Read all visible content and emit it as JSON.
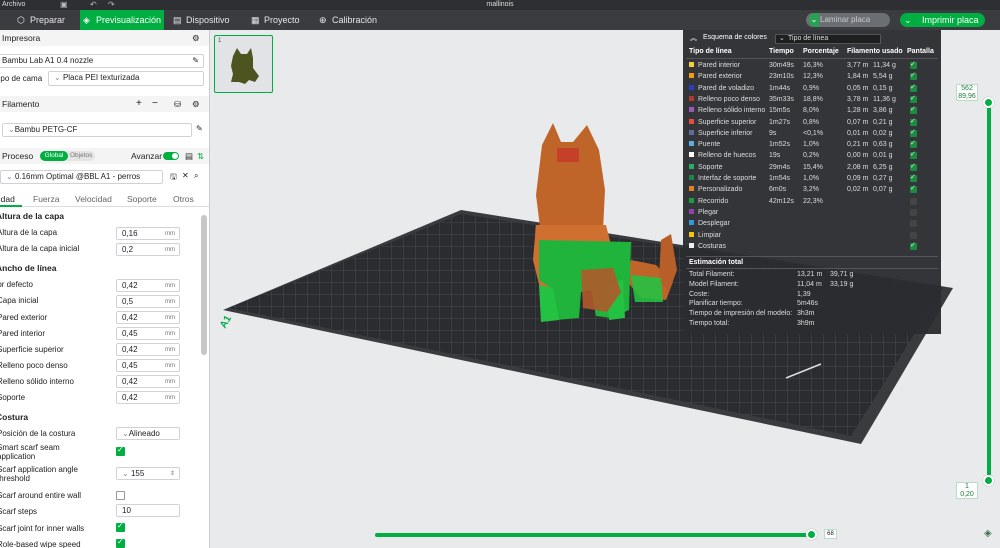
{
  "window": {
    "menu_label": "Archivo",
    "title": "mallinois"
  },
  "tabs": [
    {
      "label": "Preparar",
      "icon": "cube-icon"
    },
    {
      "label": "Previsualización",
      "icon": "preview-icon"
    },
    {
      "label": "Dispositivo",
      "icon": "device-icon"
    },
    {
      "label": "Proyecto",
      "icon": "project-icon"
    },
    {
      "label": "Calibración",
      "icon": "calibration-icon"
    }
  ],
  "toolbar": {
    "slice_label": "Laminar placa",
    "print_label": "Imprimir placa"
  },
  "printer": {
    "section_label": "Impresora",
    "name": "Bambu Lab A1 0.4 nozzle",
    "bed_label": "Tipo de cama",
    "bed_value": "Placa PEI texturizada"
  },
  "filament": {
    "section_label": "Filamento",
    "value": "Bambu PETG-CF"
  },
  "process": {
    "section_label": "Proceso",
    "toggle_global": "Global",
    "toggle_objects": "Objetos",
    "advanced_label": "Avanzar",
    "preset": "0.16mm Optimal @BBL A1 - perros"
  },
  "subtabs": [
    "Calidad",
    "Fuerza",
    "Velocidad",
    "Soporte",
    "Otros"
  ],
  "quality": {
    "layer_height": {
      "title": "Altura de la capa",
      "rows": [
        {
          "label": "Altura de la capa",
          "value": "0,16",
          "unit": "mm"
        },
        {
          "label": "Altura de la capa inicial",
          "value": "0,2",
          "unit": "mm"
        }
      ]
    },
    "line_width": {
      "title": "Ancho de línea",
      "rows": [
        {
          "label": "Por defecto",
          "value": "0,42",
          "unit": "mm"
        },
        {
          "label": "Capa inicial",
          "value": "0,5",
          "unit": "mm"
        },
        {
          "label": "Pared exterior",
          "value": "0,42",
          "unit": "mm"
        },
        {
          "label": "Pared interior",
          "value": "0,45",
          "unit": "mm"
        },
        {
          "label": "Superficie superior",
          "value": "0,42",
          "unit": "mm"
        },
        {
          "label": "Relleno poco denso",
          "value": "0,45",
          "unit": "mm"
        },
        {
          "label": "Relleno sólido interno",
          "value": "0,42",
          "unit": "mm"
        },
        {
          "label": "Soporte",
          "value": "0,42",
          "unit": "mm"
        }
      ]
    },
    "seam": {
      "title": "Costura",
      "position_label": "Posición de la costura",
      "position_value": "Alineado",
      "smart_scarf_label_1": "Smart scarf seam",
      "smart_scarf_label_2": "application",
      "scarf_angle_label_1": "Scarf application angle",
      "scarf_angle_label_2": "threshold",
      "scarf_angle_value": "155",
      "scarf_around_label": "Scarf around entire wall",
      "scarf_steps_label": "Scarf steps",
      "scarf_steps_value": "10",
      "scarf_inner_label": "Scarf joint for inner walls",
      "role_wipe_label": "Role-based wipe speed"
    }
  },
  "thumbnail": {
    "number": "1"
  },
  "color_scheme": {
    "title": "Esquema de colores",
    "selector": "Tipo de línea",
    "headers": [
      "Tipo de línea",
      "Tiempo",
      "Porcentaje",
      "Filamento usado",
      "Pantalla"
    ],
    "rows": [
      {
        "name": "Pared interior",
        "color": "#f4d03f",
        "time": "30m49s",
        "pct": "16,3%",
        "m": "3,77 m",
        "g": "11,34 g",
        "on": true
      },
      {
        "name": "Pared exterior",
        "color": "#f39c12",
        "time": "23m10s",
        "pct": "12,3%",
        "m": "1,84 m",
        "g": "5,54 g",
        "on": true
      },
      {
        "name": "Pared de voladizo",
        "color": "#2c3ec9",
        "time": "1m44s",
        "pct": "0,9%",
        "m": "0,05 m",
        "g": "0,15 g",
        "on": true
      },
      {
        "name": "Relleno poco denso",
        "color": "#b03a2e",
        "time": "35m33s",
        "pct": "18,8%",
        "m": "3,78 m",
        "g": "11,36 g",
        "on": true
      },
      {
        "name": "Relleno sólido interno",
        "color": "#9b59b6",
        "time": "15m5s",
        "pct": "8,0%",
        "m": "1,28 m",
        "g": "3,86 g",
        "on": true
      },
      {
        "name": "Superficie superior",
        "color": "#e74c3c",
        "time": "1m27s",
        "pct": "0,8%",
        "m": "0,07 m",
        "g": "0,21 g",
        "on": true
      },
      {
        "name": "Superficie inferior",
        "color": "#5d6d9e",
        "time": "9s",
        "pct": "<0,1%",
        "m": "0,01 m",
        "g": "0,02 g",
        "on": true
      },
      {
        "name": "Puente",
        "color": "#5dade2",
        "time": "1m52s",
        "pct": "1,0%",
        "m": "0,21 m",
        "g": "0,63 g",
        "on": true
      },
      {
        "name": "Relleno de huecos",
        "color": "#ffffff",
        "time": "19s",
        "pct": "0,2%",
        "m": "0,00 m",
        "g": "0,01 g",
        "on": true
      },
      {
        "name": "Soporte",
        "color": "#27ae60",
        "time": "29m4s",
        "pct": "15,4%",
        "m": "2,08 m",
        "g": "6,25 g",
        "on": true
      },
      {
        "name": "Interfaz de soporte",
        "color": "#1e8449",
        "time": "1m54s",
        "pct": "1,0%",
        "m": "0,09 m",
        "g": "0,27 g",
        "on": true
      },
      {
        "name": "Personalizado",
        "color": "#e67e22",
        "time": "6m0s",
        "pct": "3,2%",
        "m": "0,02 m",
        "g": "0,07 g",
        "on": true
      },
      {
        "name": "Recorrido",
        "color": "#1c9c3c",
        "time": "42m12s",
        "pct": "22,3%",
        "m": "",
        "g": "",
        "on": false
      },
      {
        "name": "Plegar",
        "color": "#8e44ad",
        "time": "",
        "pct": "",
        "m": "",
        "g": "",
        "on": false
      },
      {
        "name": "Desplegar",
        "color": "#3498db",
        "time": "",
        "pct": "",
        "m": "",
        "g": "",
        "on": false
      },
      {
        "name": "Limpiar",
        "color": "#f1c40f",
        "time": "",
        "pct": "",
        "m": "",
        "g": "",
        "on": false
      },
      {
        "name": "Costuras",
        "color": "#eeeeee",
        "time": "",
        "pct": "",
        "m": "",
        "g": "",
        "on": true
      }
    ],
    "estimate": {
      "title": "Estimación total",
      "rows": [
        {
          "label": "Total Filament:",
          "v1": "13,21 m",
          "v2": "39,71 g"
        },
        {
          "label": "Model Filament:",
          "v1": "11,04 m",
          "v2": "33,19 g"
        },
        {
          "label": "Coste:",
          "v1": "1,39",
          "v2": ""
        },
        {
          "label": "Planificar tiempo:",
          "v1": "5m46s",
          "v2": ""
        },
        {
          "label": "Tiempo de impresión del modelo:",
          "v1": "3h3m",
          "v2": ""
        },
        {
          "label": "Tiempo total:",
          "v1": "3h9m",
          "v2": ""
        }
      ]
    }
  },
  "layer_slider": {
    "top_layer": "562",
    "top_height": "89,96",
    "bottom_layer": "1",
    "bottom_height": "0,20"
  },
  "move_slider": {
    "value": "68"
  },
  "bed": {
    "label": "A1"
  }
}
